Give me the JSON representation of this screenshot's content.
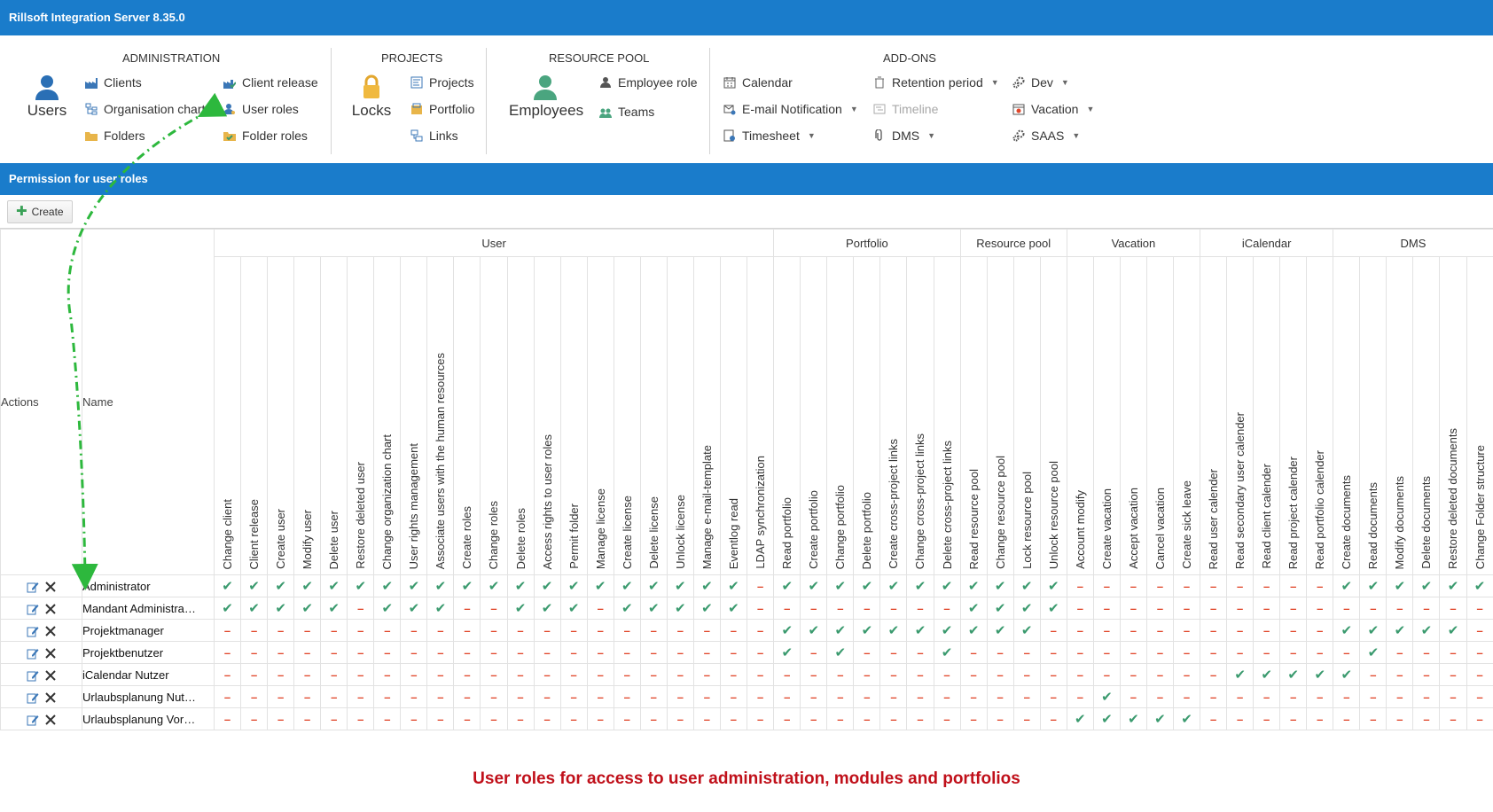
{
  "app_title": "Rillsoft Integration Server 8.35.0",
  "ribbon": {
    "administration": {
      "title": "ADMINISTRATION",
      "users": "Users",
      "clients": "Clients",
      "org_chart": "Organisation chart",
      "folders": "Folders",
      "client_release": "Client release",
      "user_roles": "User roles",
      "folder_roles": "Folder roles"
    },
    "projects": {
      "title": "PROJECTS",
      "locks": "Locks",
      "projects": "Projects",
      "portfolio": "Portfolio",
      "links": "Links"
    },
    "resource_pool": {
      "title": "RESOURCE POOL",
      "employees": "Employees",
      "employee_role": "Employee role",
      "teams": "Teams"
    },
    "addons": {
      "title": "ADD-ONS",
      "calendar": "Calendar",
      "email_notification": "E-mail Notification",
      "timesheet": "Timesheet",
      "retention_period": "Retention period",
      "timeline": "Timeline",
      "dms": "DMS",
      "dev": "Dev",
      "vacation": "Vacation",
      "saas": "SAAS"
    }
  },
  "section_title": "Permission for user roles",
  "create_label": "Create",
  "grid": {
    "actions_header": "Actions",
    "name_header": "Name",
    "groups": [
      {
        "label": "User",
        "span": 21
      },
      {
        "label": "Portfolio",
        "span": 7
      },
      {
        "label": "Resource pool",
        "span": 4
      },
      {
        "label": "Vacation",
        "span": 5
      },
      {
        "label": "iCalendar",
        "span": 5
      },
      {
        "label": "DMS",
        "span": 6
      }
    ],
    "columns": [
      "Change client",
      "Client release",
      "Create user",
      "Modify user",
      "Delete user",
      "Restore deleted user",
      "Change organization chart",
      "User rights management",
      "Associate users with the human resources",
      "Create roles",
      "Change roles",
      "Delete roles",
      "Access rights to user roles",
      "Permit folder",
      "Manage license",
      "Create license",
      "Delete license",
      "Unlock license",
      "Manage e-mail-template",
      "Eventlog read",
      "LDAP synchronization",
      "Read portfolio",
      "Create portfolio",
      "Change portfolio",
      "Delete portfolio",
      "Create cross-project links",
      "Change cross-project links",
      "Delete cross-project links",
      "Read resource pool",
      "Change resource pool",
      "Lock resource pool",
      "Unlock resource pool",
      "Account modify",
      "Create vacation",
      "Accept vacation",
      "Cancel vacation",
      "Create sick leave",
      "Read user calender",
      "Read secondary user calender",
      "Read client calender",
      "Read project calender",
      "Read portfolio calender",
      "Create documents",
      "Read documents",
      "Modify documents",
      "Delete documents",
      "Restore deleted documents",
      "Change Folder structure"
    ],
    "rows": [
      {
        "name": "Administrator",
        "perms": "11111111111111111111011111111111000000000011111111"
      },
      {
        "name": "Mandant Administra…",
        "perms": "11111011100111011111000000001111000000000000000001"
      },
      {
        "name": "Projektmanager",
        "perms": "00000000000000000000011111111110000000000011111000"
      },
      {
        "name": "Projektbenutzer",
        "perms": "00000000000000000000010100010000000000000001000000"
      },
      {
        "name": "iCalendar Nutzer",
        "perms": "00000000000000000000000000000000000000111110000000"
      },
      {
        "name": "Urlaubsplanung Nut…",
        "perms": "00000000000000000000000000000000010000000000000000"
      },
      {
        "name": "Urlaubsplanung Vor…",
        "perms": "00000000000000000000000000000000111110000000000000"
      }
    ]
  },
  "caption": "User roles for access to user administration, modules and portfolios",
  "colors": {
    "brand_blue": "#1a7ccb",
    "check_green": "#3a9a6e",
    "dash_red": "#e0462a",
    "caption_red": "#c0101a",
    "arrow_green": "#2db83d"
  },
  "icons": {
    "check": "✔",
    "dash": "–",
    "edit": "edit-icon",
    "delete": "delete-icon"
  }
}
